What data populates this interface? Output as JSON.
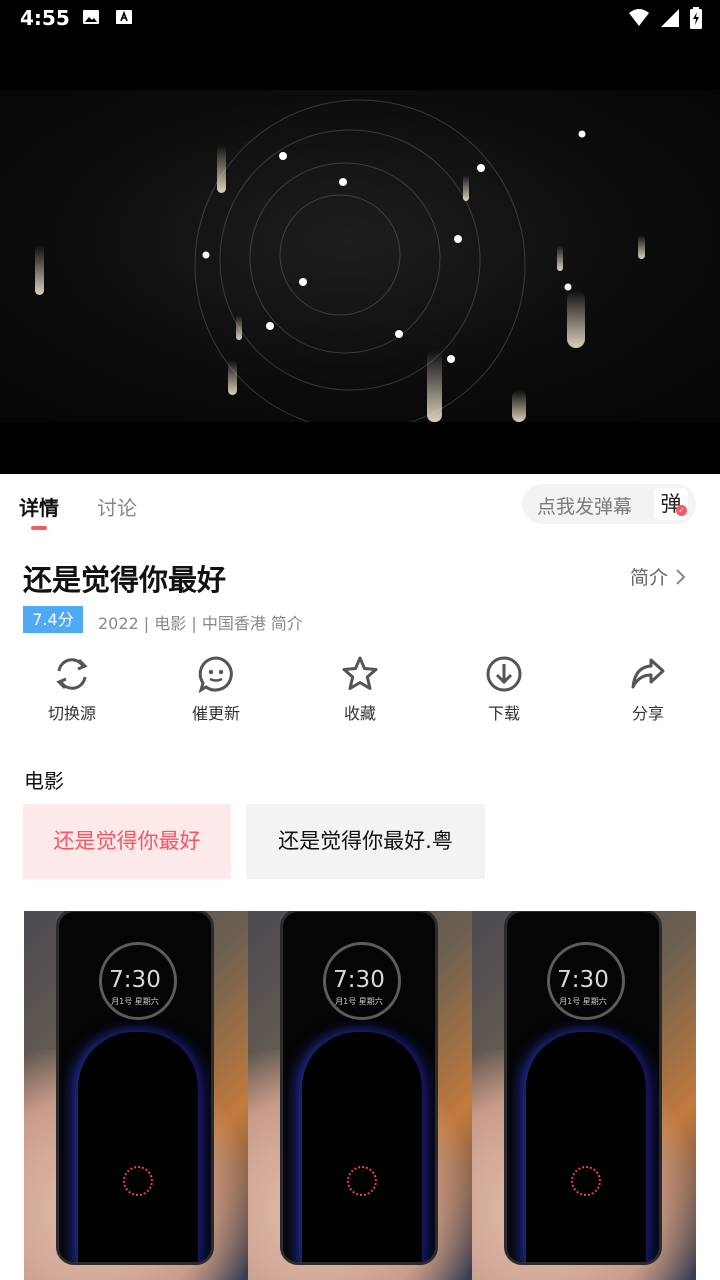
{
  "status_bar": {
    "time": "4:55"
  },
  "tabs": {
    "details": "详情",
    "discussion": "讨论"
  },
  "danmaku": {
    "placeholder": "点我发弹幕",
    "icon_char": "弹"
  },
  "movie": {
    "title": "还是觉得你最好",
    "intro_label": "简介",
    "rating": "7.4分",
    "meta": "2022 | 电影 | 中国香港 简介"
  },
  "actions": [
    {
      "label": "切换源",
      "icon": "refresh-icon"
    },
    {
      "label": "催更新",
      "icon": "chat-icon"
    },
    {
      "label": "收藏",
      "icon": "star-icon"
    },
    {
      "label": "下载",
      "icon": "download-icon"
    },
    {
      "label": "分享",
      "icon": "share-icon"
    }
  ],
  "section": {
    "title": "电影",
    "sources": [
      "还是觉得你最好",
      "还是觉得你最好.粤"
    ]
  },
  "banner": {
    "clock": "7:30",
    "date": "月1号 星期六"
  },
  "colors": {
    "accent": "#f05a64",
    "rating_bg": "#4fa9f4"
  }
}
